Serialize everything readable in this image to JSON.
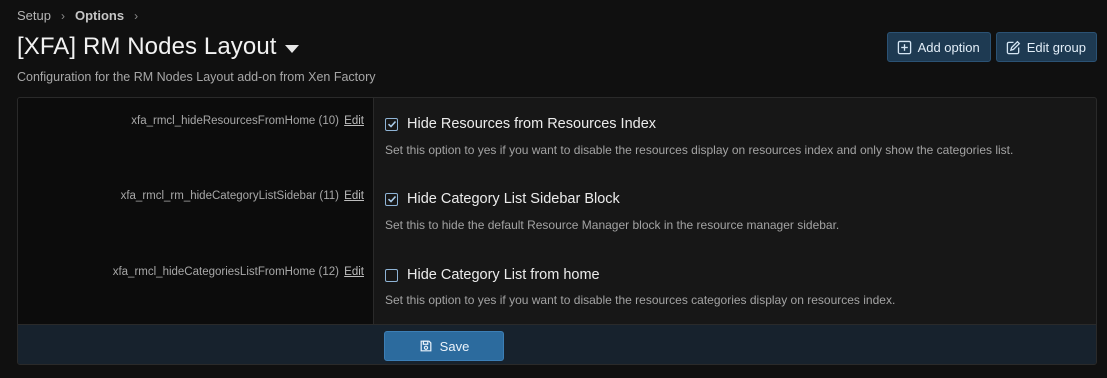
{
  "breadcrumb": {
    "items": [
      {
        "label": "Setup"
      },
      {
        "label": "Options"
      }
    ]
  },
  "page": {
    "title": "[XFA] RM Nodes Layout",
    "description": "Configuration for the RM Nodes Layout add-on from Xen Factory"
  },
  "actions": {
    "add_option": "Add option",
    "edit_group": "Edit group"
  },
  "options": [
    {
      "key": "xfa_rmcl_hideResourcesFromHome (10)",
      "edit": "Edit",
      "label": "Hide Resources from Resources Index",
      "checked": true,
      "hint": "Set this option to yes if you want to disable the resources display on resources index and only show the categories list."
    },
    {
      "key": "xfa_rmcl_rm_hideCategoryListSidebar (11)",
      "edit": "Edit",
      "label": "Hide Category List Sidebar Block",
      "checked": true,
      "hint": "Set this to hide the default Resource Manager block in the resource manager sidebar."
    },
    {
      "key": "xfa_rmcl_hideCategoriesListFromHome (12)",
      "edit": "Edit",
      "label": "Hide Category List from home",
      "checked": false,
      "hint": "Set this option to yes if you want to disable the resources categories display on resources index."
    }
  ],
  "form": {
    "save_label": "Save"
  },
  "colors": {
    "accent": "#2c6b9e",
    "header_button": "#1e3a52",
    "checkbox_border": "#8fb4d6"
  }
}
